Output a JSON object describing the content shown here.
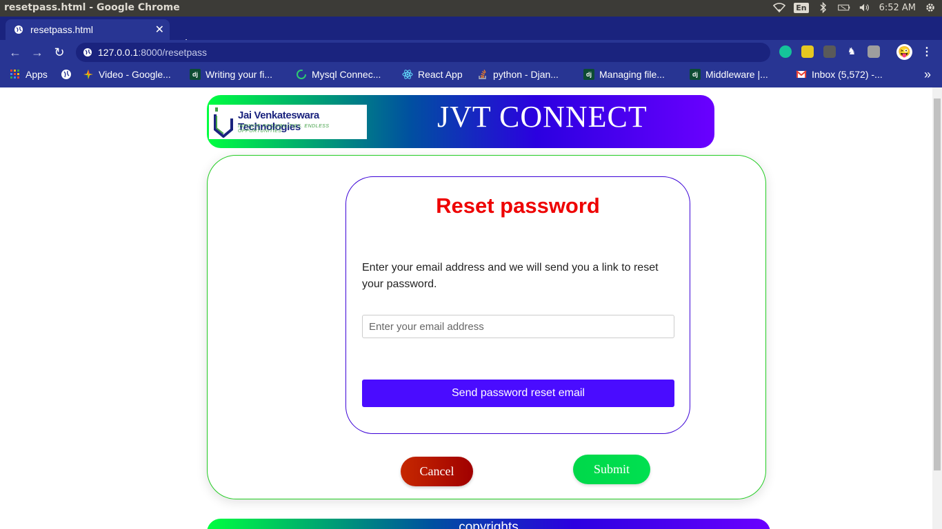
{
  "os": {
    "window_title": "resetpass.html - Google Chrome",
    "keyboard_layout": "En",
    "time": "6:52 AM"
  },
  "browser": {
    "tab_title": "resetpass.html",
    "url_host": "127.0.0.1",
    "url_rest": ":8000/resetpass",
    "bookmarks": [
      {
        "label": "Apps",
        "icon": "apps-grid-icon"
      },
      {
        "label": "",
        "icon": "globe-icon"
      },
      {
        "label": "Video - Google...",
        "icon": "google-video-icon"
      },
      {
        "label": "Writing your fi...",
        "icon": "django-icon"
      },
      {
        "label": "Mysql Connec...",
        "icon": "loading-ring-icon"
      },
      {
        "label": "React App",
        "icon": "react-icon"
      },
      {
        "label": "python - Djan...",
        "icon": "stackoverflow-icon"
      },
      {
        "label": "Managing file...",
        "icon": "django-icon"
      },
      {
        "label": "Middleware |...",
        "icon": "django-icon"
      },
      {
        "label": "Inbox (5,572) -...",
        "icon": "gmail-icon"
      }
    ],
    "more_bookmarks": "»"
  },
  "page": {
    "logo_name": "Jai Venkateswara Technologies",
    "logo_tagline": "INFINITE POSSIBILITIES. ENDLESS OPPORTUNITIES.",
    "banner_title": "JVT CONNECT",
    "reset_title": "Reset password",
    "description": "Enter your email address and we will send you a link to reset your password.",
    "email_placeholder": "Enter your email address",
    "send_button": "Send password reset email",
    "cancel_button": "Cancel",
    "submit_button": "Submit",
    "footer_text": "copyrights"
  },
  "colors": {
    "browser_frame": "#283593",
    "reset_title": "#ee0000",
    "send_button": "#4a0cff",
    "cancel_button": "#b01400",
    "submit_button": "#00dd4d",
    "outer_border": "#22cc22",
    "inner_border": "#3a00d6"
  }
}
